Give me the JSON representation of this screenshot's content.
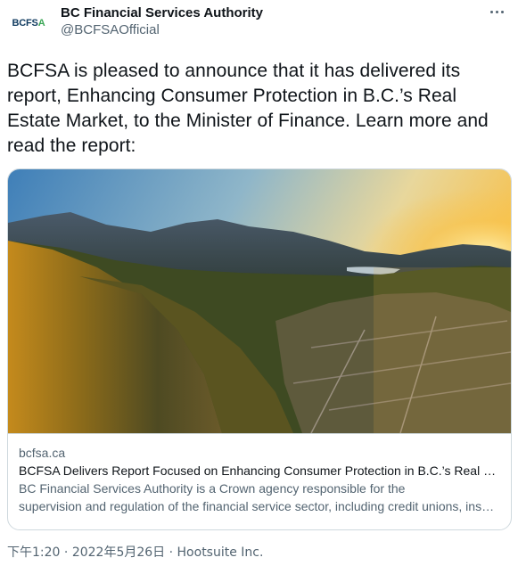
{
  "header": {
    "avatar": {
      "logo_main": "BCFS",
      "logo_accent": "A",
      "brand_color": "#0f3a5f",
      "accent_color": "#3aa655"
    },
    "display_name": "BC Financial Services Authority",
    "handle": "@BCFSAOfficial",
    "more_icon": "more-horizontal-icon"
  },
  "tweet": {
    "text": "BCFSA is pleased to announce that it has delivered its report, Enhancing Consumer Protection in B.C.’s Real Estate Market, to the Minister of Finance. Learn more and read the report:"
  },
  "card": {
    "domain": "bcfsa.ca",
    "title": "BCFSA Delivers Report Focused on Enhancing Consumer Protection in B.C.’s Real Estate Market",
    "description_line1": "BC Financial Services Authority is a Crown agency responsible for the",
    "description_line2": "supervision and regulation of the financial service sector, including credit unions, insurance companies, trust companies, pension plans and the real estate sector"
  },
  "meta": {
    "time": "下午1:20",
    "separator1": " · ",
    "date": "2022年5月26日",
    "separator2": " · ",
    "source": "Hootsuite Inc."
  },
  "colors": {
    "text_primary": "#0f1419",
    "text_secondary": "#536471",
    "border": "#cfd9de"
  }
}
